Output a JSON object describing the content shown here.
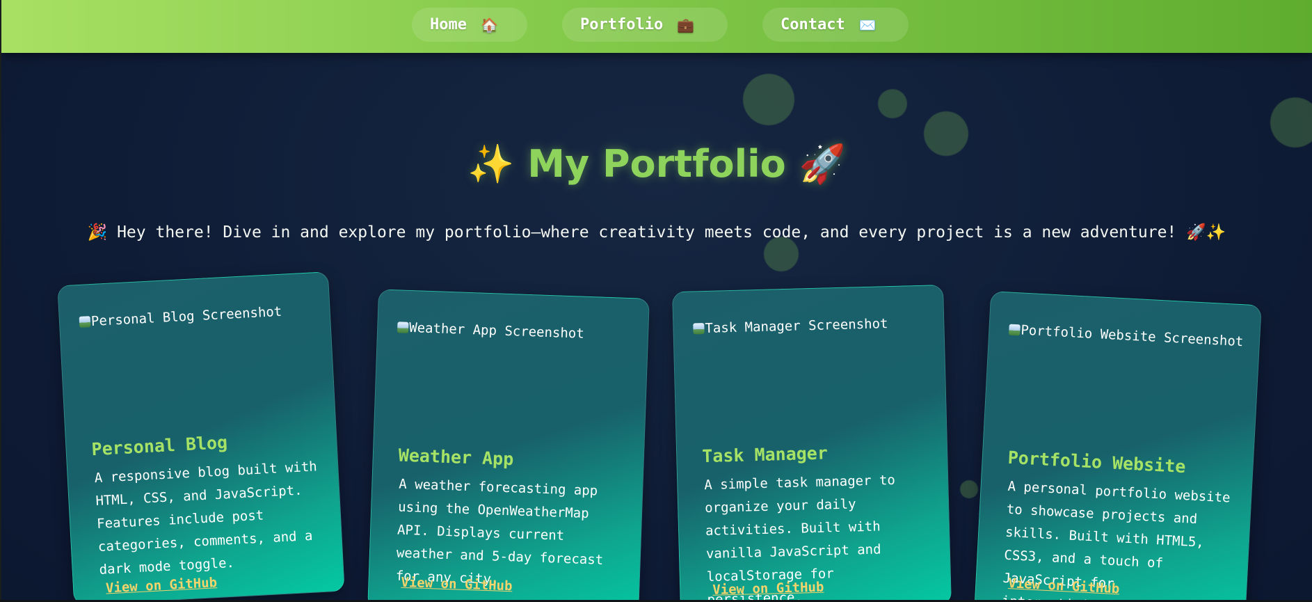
{
  "nav": {
    "items": [
      {
        "label": "Home",
        "icon": "🏠"
      },
      {
        "label": "Portfolio",
        "icon": "💼"
      },
      {
        "label": "Contact",
        "icon": "✉️"
      }
    ]
  },
  "hero": {
    "title": "✨ My Portfolio 🚀",
    "subtitle": "🎉 Hey there! Dive in and explore my portfolio—where creativity meets code, and every project is a new adventure! 🚀✨"
  },
  "projects": [
    {
      "image_alt": "Personal Blog Screenshot",
      "title": "Personal Blog",
      "description": "A responsive blog built with HTML, CSS, and JavaScript. Features include post categories, comments, and a dark mode toggle.",
      "link": "View on GitHub"
    },
    {
      "image_alt": "Weather App Screenshot",
      "title": "Weather App",
      "description": "A weather forecasting app using the OpenWeatherMap API. Displays current weather and 5-day forecast for any city.",
      "link": "View on GitHub"
    },
    {
      "image_alt": "Task Manager Screenshot",
      "title": "Task Manager",
      "description": "A simple task manager to organize your daily activities. Built with vanilla JavaScript and localStorage for persistence.",
      "link": "View on GitHub"
    },
    {
      "image_alt": "Portfolio Website Screenshot",
      "title": "Portfolio Website",
      "description": "A personal portfolio website to showcase projects and skills. Built with HTML5, CSS3, and a touch of JavaScript for interactivity.",
      "link": "View on GitHub"
    }
  ],
  "colors": {
    "nav_gradient_start": "#a8e063",
    "nav_gradient_end": "#5fad2f",
    "page_background": "#0f1c36",
    "title_green": "#8ed35b",
    "card_title_green": "#a6e265",
    "link_yellow": "#f3d36b",
    "card_teal": "#04c9a2"
  }
}
